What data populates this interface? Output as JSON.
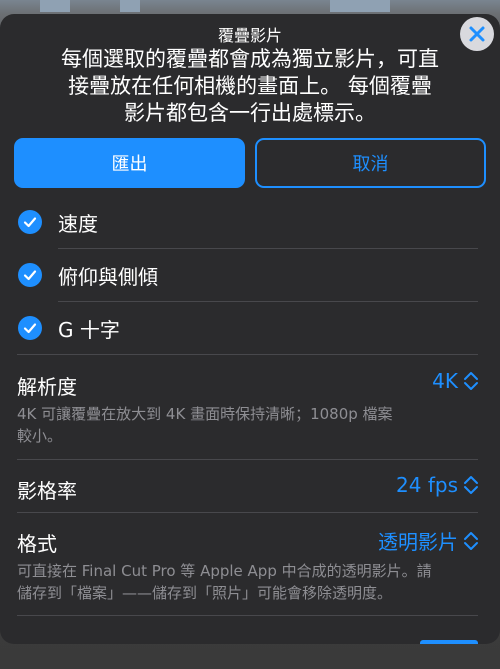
{
  "sheet": {
    "title": "覆疊影片",
    "description": "每個選取的覆疊都會成為獨立影片，可直接疊放在任何相機的畫面上。 每個覆疊影片都包含一行出處標示。",
    "desc_lines": [
      "每個選取的覆疊都會成為獨立影片，可直",
      "接疊放在任何相機的畫面上。 每個覆疊",
      "影片都包含一行出處標示。"
    ]
  },
  "buttons": {
    "export_label": "匯出",
    "cancel_label": "取消"
  },
  "overlays": [
    {
      "label": "速度",
      "checked": true
    },
    {
      "label": "俯仰與側傾",
      "checked": true
    },
    {
      "label": "G 十字",
      "checked": true
    }
  ],
  "settings": {
    "resolution": {
      "label": "解析度",
      "value": "4K",
      "desc_lines": [
        "4K 可讓覆疊在放大到 4K 畫面時保持清晰；1080p 檔案",
        "較小。"
      ]
    },
    "frame_rate": {
      "label": "影格率",
      "value": "24 fps"
    },
    "format": {
      "label": "格式",
      "value": "透明影片",
      "desc_lines": [
        "可直接在 Final Cut Pro 等 Apple App 中合成的透明影片。請",
        "儲存到「檔案」——儲存到「照片」可能會移除透明度。"
      ]
    }
  },
  "colors": {
    "accent": "#1e8fff",
    "sheet_bg": "#2b2b2d",
    "secondary_text": "#8e8e93"
  },
  "icons": {
    "close": "close-x-icon",
    "check": "checkmark-icon",
    "stepper": "up-down-chevron-icon"
  }
}
